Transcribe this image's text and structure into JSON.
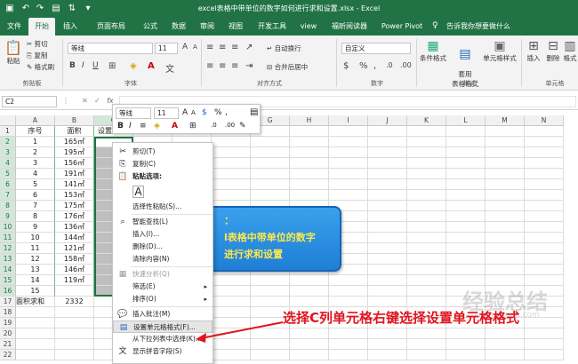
{
  "window": {
    "title": "excel表格中带单位的数字如何进行求和设置.xlsx  -  Excel"
  },
  "tabs": [
    "文件",
    "开始",
    "插入",
    "页面布局",
    "公式",
    "数据",
    "审阅",
    "视图",
    "开发工具",
    "view",
    "福昕阅读器",
    "Power Pivot",
    "告诉我你想要做什么"
  ],
  "ribbon": {
    "clipboard": {
      "paste": "粘贴",
      "cut": "剪切",
      "copy": "复制",
      "format_painter": "格式刷",
      "label": "剪贴板"
    },
    "font": {
      "name": "等线",
      "size": "11",
      "label": "字体",
      "grow": "A",
      "shrink": "A",
      "wen": "文"
    },
    "alignment": {
      "wrap": "自动换行",
      "merge": "合并后居中",
      "label": "对齐方式"
    },
    "number": {
      "format": "自定义",
      "label": "数字"
    },
    "styles": {
      "cond": "条件格式",
      "table": "套用\n表格格式",
      "cell": "单元格样式",
      "label": "样式"
    },
    "cells": {
      "insert": "插入",
      "delete": "删除",
      "format": "格式",
      "label": "单元格"
    }
  },
  "formula_bar": {
    "name_box": "C2",
    "fx": "fx"
  },
  "columns": [
    "A",
    "B",
    "C",
    "D",
    "E",
    "F",
    "G",
    "H",
    "I",
    "J",
    "K",
    "L",
    "M",
    "N"
  ],
  "rows": [
    "1",
    "2",
    "3",
    "4",
    "5",
    "6",
    "7",
    "8",
    "9",
    "10",
    "11",
    "12",
    "13",
    "14",
    "15",
    "16",
    "17",
    "18",
    "19",
    "20",
    "21",
    "22"
  ],
  "cells": {
    "A": [
      "序号",
      "1",
      "2",
      "3",
      "4",
      "5",
      "6",
      "7",
      "8",
      "9",
      "10",
      "11",
      "12",
      "13",
      "14",
      "15",
      "面积求和",
      "",
      "",
      "",
      "",
      ""
    ],
    "B": [
      "面积",
      "165㎡",
      "195㎡",
      "156㎡",
      "191㎡",
      "141㎡",
      "153㎡",
      "175㎡",
      "176㎡",
      "136㎡",
      "144㎡",
      "121㎡",
      "158㎡",
      "146㎡",
      "119㎡",
      "",
      "2332",
      "",
      "",
      "",
      "",
      ""
    ],
    "C": [
      "设置单元格格式",
      "",
      "",
      "",
      "",
      "",
      "",
      "",
      "",
      "",
      "",
      "",
      "",
      "",
      "",
      "",
      "",
      "",
      "",
      "",
      "",
      ""
    ]
  },
  "mini_toolbar": {
    "font": "等线",
    "size": "11",
    "grow": "A",
    "shrink": "A",
    "percent": "%",
    "bold": "B",
    "italic": "I"
  },
  "context_menu": [
    {
      "label": "剪切(T)",
      "icon": "scissors-icon",
      "glyph": "✂",
      "disabled": false
    },
    {
      "label": "复制(C)",
      "icon": "copy-icon",
      "glyph": "⎘",
      "disabled": false
    },
    {
      "label": "粘贴选项:",
      "icon": "paste-icon",
      "glyph": "📋",
      "disabled": false,
      "bold": true
    },
    {
      "label": "",
      "icon": "paste-option-icon",
      "glyph": "A",
      "disabled": false
    },
    {
      "label": "选择性粘贴(S)...",
      "icon": "",
      "glyph": "",
      "disabled": false
    },
    {
      "label": "智能查找(L)",
      "icon": "search-icon",
      "glyph": "⌕",
      "disabled": false
    },
    {
      "label": "插入(I)...",
      "icon": "",
      "glyph": "",
      "disabled": false
    },
    {
      "label": "删除(D)...",
      "icon": "",
      "glyph": "",
      "disabled": false
    },
    {
      "label": "清除内容(N)",
      "icon": "",
      "glyph": "",
      "disabled": false
    },
    {
      "label": "快速分析(Q)",
      "icon": "quick-analysis-icon",
      "glyph": "▦",
      "disabled": true
    },
    {
      "label": "筛选(E)",
      "icon": "",
      "glyph": "",
      "disabled": false,
      "submenu": true
    },
    {
      "label": "排序(O)",
      "icon": "",
      "glyph": "",
      "disabled": false,
      "submenu": true
    },
    {
      "label": "插入批注(M)",
      "icon": "comment-icon",
      "glyph": "💬",
      "disabled": false
    },
    {
      "label": "设置单元格格式(F)...",
      "icon": "format-cells-icon",
      "glyph": "▤",
      "disabled": false
    },
    {
      "label": "从下拉列表中选择(K)...",
      "icon": "",
      "glyph": "",
      "disabled": false
    },
    {
      "label": "显示拼音字段(S)",
      "icon": "pinyin-icon",
      "glyph": "文",
      "disabled": false
    }
  ],
  "card": {
    "line1": "：",
    "line2": "l表格中带单位的数字",
    "line3": "进行求和设置"
  },
  "annotation": "选择C列单元格右键选择设置单元格格式",
  "watermark": {
    "main": "经验总结",
    "sub": "zhinan.sogou.com"
  },
  "colors": {
    "excel_green": "#217346",
    "annotation_red": "#e1141e",
    "card_blue": "#2b8ee2",
    "selection_green": "#c6e0cc"
  }
}
